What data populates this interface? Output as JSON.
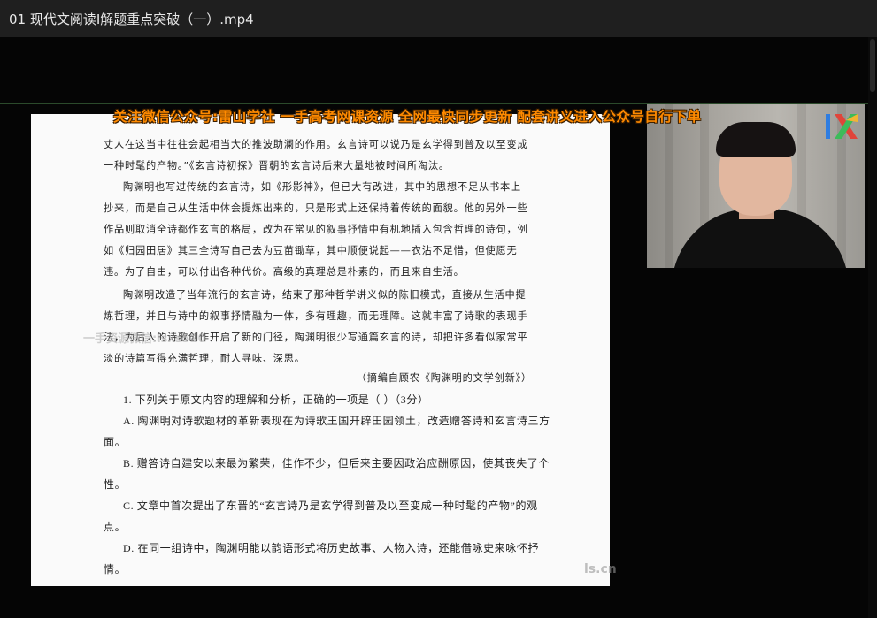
{
  "window": {
    "title": "01 现代文阅读Ⅰ解题重点突破（一）.mp4"
  },
  "overlay": {
    "banner": "关注微信公众号:雷山学社 一手高考网课资源 全网最快同步更新 配套讲义进入公众号自行下单",
    "faint_watermark": "一手资源微信:lsxs520",
    "site_watermark": "ls.cn"
  },
  "document": {
    "lines": [
      "丈人在这当中往往会起相当大的推波助澜的作用。玄言诗可以说乃是玄学得到普及以至变成",
      "一种时髦的产物。”《玄言诗初探》晋朝的玄言诗后来大量地被时间所淘汰。",
      "陶渊明也写过传统的玄言诗，如《形影神》，但已大有改进，其中的思想不足从书本上",
      "抄来，而是自己从生活中体会提炼出来的，只是形式上还保持着传统的面貌。他的另外一些",
      "作品则取消全诗都作玄言的格局，改为在常见的叙事抒情中有机地插入包含哲理的诗句，例",
      "如《归园田居》其三全诗写自己去为豆苗锄草，其中顺便说起——衣沾不足惜，但使愿无",
      "违。为了自由，可以付出各种代价。高级的真理总是朴素的，而且来自生活。",
      "陶渊明改造了当年流行的玄言诗，结束了那种哲学讲义似的陈旧模式，直接从生活中提",
      "炼哲理，并且与诗中的叙事抒情融为一体，多有理趣，而无理障。这就丰富了诗歌的表现手",
      "法，为后人的诗歌创作开启了新的门径，陶渊明很少写通篇玄言的诗，却把许多看似家常平",
      "淡的诗篇写得充满哲理，耐人寻味、深思。"
    ],
    "source": "（摘编自顾农《陶渊明的文学创新》）",
    "question_lines": [
      "1. 下列关于原文内容的理解和分析，正确的一项是（    ）（3分）",
      "A. 陶渊明对诗歌题材的革新表现在为诗歌王国开辟田园领土，改造赠答诗和玄言诗三方",
      "面。",
      "B. 赠答诗自建安以来最为繁荣，佳作不少，但后来主要因政治应酬原因，使其丧失了个",
      "性。",
      "C. 文章中首次提出了东晋的“玄言诗乃是玄学得到普及以至变成一种时髦的产物”的观",
      "点。",
      "D. 在同一组诗中，陶渊明能以韵语形式将历史故事、人物入诗，还能借咏史来咏怀抒",
      "情。"
    ]
  },
  "colors": {
    "banner": "#ff8a00",
    "titlebar_bg": "#1f1f1f",
    "player_bg": "#050505",
    "document_bg": "#fafafa"
  },
  "icons": {
    "logo": "ix-logo-icon"
  }
}
